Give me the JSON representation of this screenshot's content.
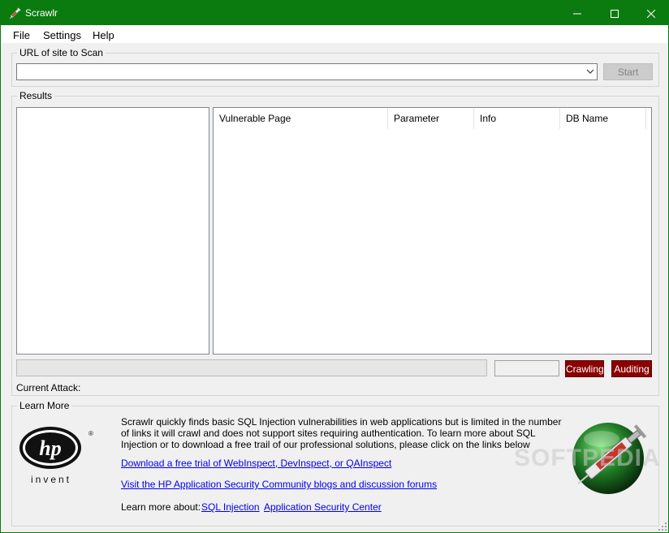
{
  "window": {
    "title": "Scrawlr",
    "accent_color": "#0c7b0f",
    "controls": {
      "minimize_icon": "minimize-icon",
      "maximize_icon": "maximize-icon",
      "close_icon": "close-icon"
    }
  },
  "menu": {
    "items": [
      "File",
      "Settings",
      "Help"
    ]
  },
  "url_group": {
    "label": "URL of site to Scan",
    "value": "",
    "start_label": "Start"
  },
  "results": {
    "label": "Results",
    "columns": [
      "Vulnerable Page",
      "Parameter",
      "Info",
      "DB Name"
    ],
    "rows": []
  },
  "status": {
    "crawling_label": "Crawling",
    "auditing_label": "Auditing",
    "current_attack_label": "Current Attack:",
    "status_color": "#8a0000"
  },
  "learn_more": {
    "label": "Learn More",
    "logo_text": "invent",
    "logo_mark": "hp",
    "description": "Scrawlr quickly finds basic SQL Injection vulnerabilities in web applications but is limited in the number of links it will crawl and does not support sites requiring authentication. To learn more about SQL Injection or to download a free trail of our professional solutions, please click on the links below",
    "link_trial": "Download a free trial of WebInspect, DevInspect, or QAInspect",
    "link_community": "Visit the HP Application Security Community blogs and discussion forums",
    "learn_about_label": "Learn more about:",
    "link_sql": "SQL Injection",
    "link_center": "Application Security Center"
  },
  "watermark": "SOFTPEDIA"
}
